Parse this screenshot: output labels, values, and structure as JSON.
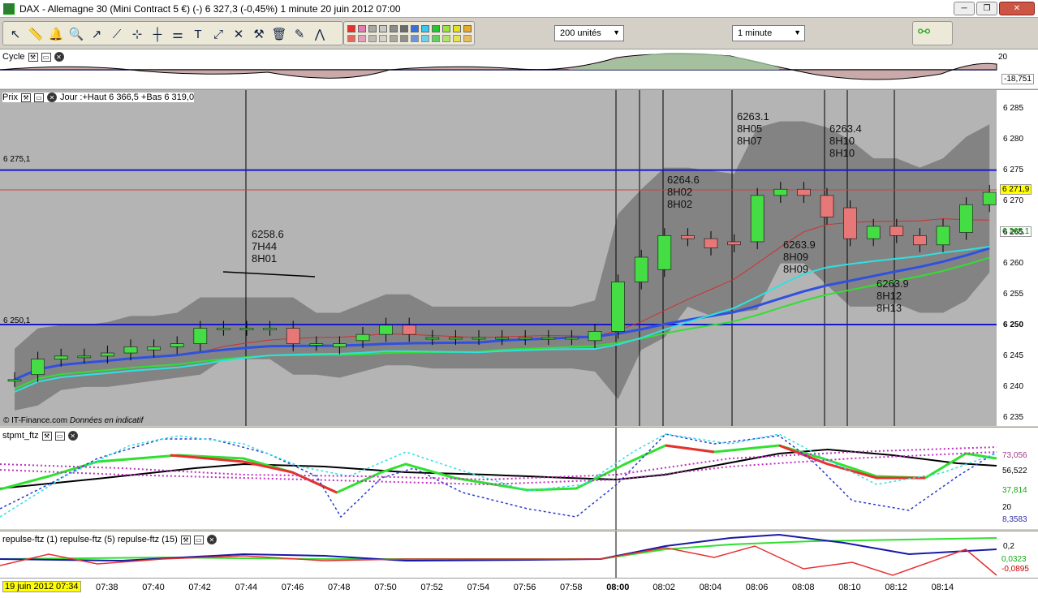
{
  "window": {
    "title": "DAX - Allemagne 30 (Mini Contract 5 €) (-)    6 327,3 (-0,45%)    1 minute  20 juin 2012 07:00"
  },
  "toolbar": {
    "tools": [
      "pointer-icon",
      "ruler-icon",
      "alert-bell-icon",
      "zoom-icon",
      "trendline-icon",
      "line-icon",
      "horizontal-line-icon",
      "vertical-line-icon",
      "fibonacci-icon",
      "text-icon",
      "arrows-icon",
      "cross-icon",
      "tools-icon",
      "trash-icon",
      "pen-icon",
      "zigzag-icon"
    ],
    "colors": [
      "#e8302b",
      "#e47bb6",
      "#a8a8a8",
      "#c8c8c8",
      "#8c8c8c",
      "#6a6a6a",
      "#3b6fd9",
      "#3cc6ef",
      "#23c830",
      "#9be33c",
      "#e2e21e",
      "#e8a92c"
    ],
    "quantity": "200 unités",
    "interval": "1 minute"
  },
  "cycle": {
    "label": "Cycle",
    "axis_top": "20",
    "axis_value": "-18,751"
  },
  "price": {
    "label": "Prix",
    "info": "Jour :+Haut 6 366,5 +Bas 6 319,0",
    "level_top": "6 275,1",
    "level_bottom": "6 250,1",
    "source": "© IT-Finance.com",
    "disclaimer": "Données en indicatif",
    "ticks": [
      "6 285",
      "6 280",
      "6 275",
      "6 270",
      "6 265",
      "6 260",
      "6 255",
      "6 250",
      "6 245",
      "6 240",
      "6 235"
    ],
    "last": "6 271,9",
    "green_value": "6 265,1",
    "annotations": [
      {
        "price": "6258.6",
        "t1": "7H44",
        "t2": "8H01"
      },
      {
        "price": "6264.6",
        "t1": "8H02",
        "t2": "8H02"
      },
      {
        "price": "6263.1",
        "t1": "8H05",
        "t2": "8H07"
      },
      {
        "price": "6263.4",
        "t1": "8H10",
        "t2": "8H10"
      },
      {
        "price": "6263.9",
        "t1": "8H09",
        "t2": "8H09"
      },
      {
        "price": "6263.9",
        "t1": "8H12",
        "t2": "8H13"
      }
    ]
  },
  "stpmt": {
    "label": "stpmt_ftz",
    "v1": "73,056",
    "v2": "56,522",
    "v3": "37,814",
    "v4": "20",
    "v5": "8,3583"
  },
  "repulse": {
    "label": "repulse-ftz (1) repulse-ftz (5) repulse-ftz (15)",
    "v1": "0,2",
    "v2": "0,0323",
    "v3": "-0,0895"
  },
  "time": {
    "date": "19 juin 2012 07:34",
    "labels": [
      "07:38",
      "07:40",
      "07:42",
      "07:44",
      "07:46",
      "07:48",
      "07:50",
      "07:52",
      "07:54",
      "07:56",
      "07:58",
      "08:00",
      "08:02",
      "08:04",
      "08:06",
      "08:08",
      "08:10",
      "08:12",
      "08:14"
    ]
  },
  "chart_data": {
    "type": "candlestick",
    "x": [
      "07:34",
      "07:35",
      "07:36",
      "07:37",
      "07:38",
      "07:39",
      "07:40",
      "07:41",
      "07:42",
      "07:43",
      "07:44",
      "07:45",
      "07:46",
      "07:47",
      "07:48",
      "07:49",
      "07:50",
      "07:51",
      "07:52",
      "07:53",
      "07:54",
      "07:55",
      "07:56",
      "07:57",
      "07:58",
      "07:59",
      "08:00",
      "08:01",
      "08:02",
      "08:03",
      "08:04",
      "08:05",
      "08:06",
      "08:07",
      "08:08",
      "08:09",
      "08:10",
      "08:11",
      "08:12",
      "08:13",
      "08:14",
      "08:15"
    ],
    "open": [
      6241.2,
      6242.0,
      6244.5,
      6245.0,
      6245.0,
      6245.5,
      6246.0,
      6246.5,
      6247.0,
      6249.5,
      6249.5,
      6249.5,
      6249.5,
      6247.0,
      6246.5,
      6247.5,
      6248.5,
      6250.0,
      6248.0,
      6248.0,
      6248.0,
      6248.0,
      6248.0,
      6248.0,
      6248.0,
      6247.5,
      6249.0,
      6257.0,
      6259.0,
      6264.5,
      6264.0,
      6263.5,
      6263.5,
      6271.0,
      6272.0,
      6271.0,
      6269.0,
      6264.0,
      6266.0,
      6264.5,
      6263.0,
      6265.0,
      6269.5
    ],
    "close": [
      6241.2,
      6244.5,
      6245.0,
      6245.0,
      6245.5,
      6246.5,
      6246.5,
      6247.0,
      6249.5,
      6249.5,
      6249.5,
      6249.5,
      6247.0,
      6247.0,
      6247.0,
      6248.5,
      6250.0,
      6248.5,
      6248.0,
      6248.0,
      6248.0,
      6248.0,
      6248.0,
      6248.0,
      6248.0,
      6249.0,
      6257.0,
      6261.0,
      6264.5,
      6264.0,
      6262.5,
      6263.0,
      6271.0,
      6272.0,
      6271.0,
      6267.5,
      6264.0,
      6266.0,
      6264.5,
      6263.0,
      6266.0,
      6269.5,
      6271.5
    ],
    "ylim": [
      6235,
      6287
    ]
  }
}
